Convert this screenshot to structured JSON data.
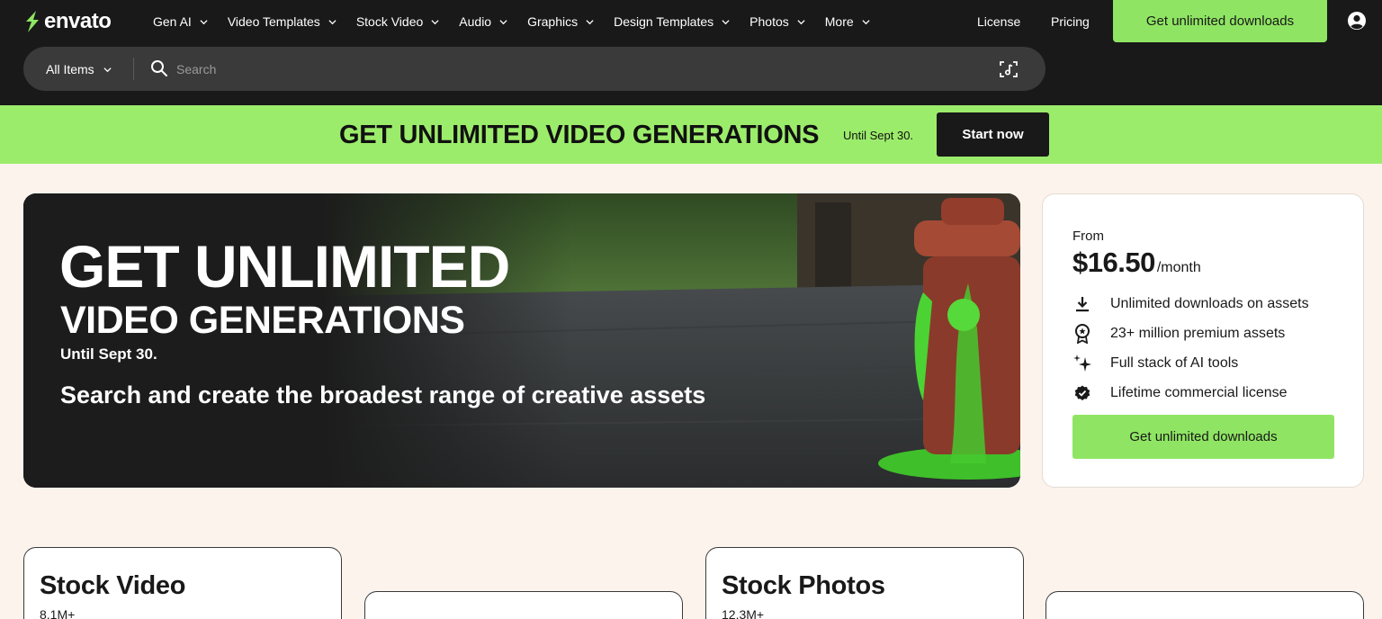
{
  "logo": {
    "text": "envato"
  },
  "nav": {
    "items": [
      {
        "label": "Gen AI"
      },
      {
        "label": "Video Templates"
      },
      {
        "label": "Stock Video"
      },
      {
        "label": "Audio"
      },
      {
        "label": "Graphics"
      },
      {
        "label": "Design Templates"
      },
      {
        "label": "Photos"
      },
      {
        "label": "More"
      }
    ],
    "license": "License",
    "pricing": "Pricing",
    "cta": "Get unlimited downloads"
  },
  "search": {
    "scope": "All Items",
    "placeholder": "Search"
  },
  "promo": {
    "title": "GET UNLIMITED VIDEO GENERATIONS",
    "until": "Until Sept 30.",
    "button": "Start now"
  },
  "hero": {
    "title_line1": "GET UNLIMITED",
    "title_line2": "VIDEO GENERATIONS",
    "until": "Until Sept 30.",
    "subtitle": "Search and create the broadest range of creative assets"
  },
  "pricing": {
    "from": "From",
    "amount": "$16.50",
    "period": "/month",
    "features": [
      {
        "icon": "download-icon",
        "text": "Unlimited downloads on assets"
      },
      {
        "icon": "award-icon",
        "text": "23+ million premium assets"
      },
      {
        "icon": "sparkle-icon",
        "text": "Full stack of AI tools"
      },
      {
        "icon": "verified-badge-icon",
        "text": "Lifetime commercial license"
      }
    ],
    "button": "Get unlimited downloads"
  },
  "categories": [
    {
      "title": "Stock Video",
      "count": "8.1M+"
    },
    {
      "title": "",
      "count": ""
    },
    {
      "title": "Stock Photos",
      "count": "12.3M+"
    },
    {
      "title": "",
      "count": ""
    }
  ],
  "colors": {
    "header_bg": "#191919",
    "accent_green": "#8fe563",
    "promo_green": "#9cec6b",
    "page_bg": "#fcf3ec"
  }
}
